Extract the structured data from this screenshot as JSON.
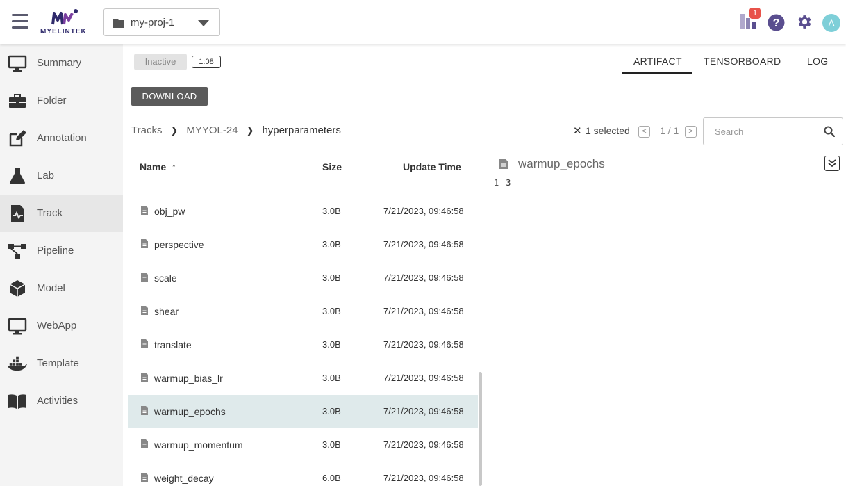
{
  "header": {
    "logo_text": "MYELINTEK",
    "project": "my-proj-1",
    "notification_count": "1",
    "avatar_initial": "A"
  },
  "sidebar": {
    "items": [
      {
        "label": "Summary",
        "icon": "monitor-icon"
      },
      {
        "label": "Folder",
        "icon": "toolbox-icon"
      },
      {
        "label": "Annotation",
        "icon": "edit-icon"
      },
      {
        "label": "Lab",
        "icon": "flask-icon"
      },
      {
        "label": "Track",
        "icon": "track-file-icon",
        "active": true
      },
      {
        "label": "Pipeline",
        "icon": "pipeline-icon"
      },
      {
        "label": "Model",
        "icon": "cube-icon"
      },
      {
        "label": "WebApp",
        "icon": "monitor-icon"
      },
      {
        "label": "Template",
        "icon": "docker-icon"
      },
      {
        "label": "Activities",
        "icon": "book-icon"
      }
    ]
  },
  "status": {
    "state": "Inactive",
    "duration": "1:08"
  },
  "tabs": {
    "artifact": "ARTIFACT",
    "tensorboard": "TENSORBOARD",
    "log": "LOG",
    "active": "ARTIFACT"
  },
  "download_label": "DOWNLOAD",
  "breadcrumb": {
    "root": "Tracks",
    "track": "MYYOL-24",
    "current": "hyperparameters"
  },
  "selection": {
    "clear_symbol": "✕",
    "text": "1 selected"
  },
  "pagination": {
    "text": "1 / 1",
    "prev": "<",
    "next": ">"
  },
  "search": {
    "placeholder": "Search",
    "value": ""
  },
  "table": {
    "headers": {
      "name": "Name",
      "size": "Size",
      "updated": "Update Time",
      "sort_arrow": "↑"
    },
    "rows": [
      {
        "name": "obj_pw",
        "size": "3.0B",
        "time": "7/21/2023, 09:46:58"
      },
      {
        "name": "perspective",
        "size": "3.0B",
        "time": "7/21/2023, 09:46:58"
      },
      {
        "name": "scale",
        "size": "3.0B",
        "time": "7/21/2023, 09:46:58"
      },
      {
        "name": "shear",
        "size": "3.0B",
        "time": "7/21/2023, 09:46:58"
      },
      {
        "name": "translate",
        "size": "3.0B",
        "time": "7/21/2023, 09:46:58"
      },
      {
        "name": "warmup_bias_lr",
        "size": "3.0B",
        "time": "7/21/2023, 09:46:58"
      },
      {
        "name": "warmup_epochs",
        "size": "3.0B",
        "time": "7/21/2023, 09:46:58",
        "selected": true
      },
      {
        "name": "warmup_momentum",
        "size": "3.0B",
        "time": "7/21/2023, 09:46:58"
      },
      {
        "name": "weight_decay",
        "size": "6.0B",
        "time": "7/21/2023, 09:46:58"
      }
    ]
  },
  "preview": {
    "title": "warmup_epochs",
    "lines": [
      {
        "number": "1",
        "content": "3"
      }
    ]
  },
  "colors": {
    "selected_row": "#dfeaeb",
    "badge": "#e8524a",
    "avatar": "#7ecfd8",
    "accent": "#5a4e8f"
  }
}
